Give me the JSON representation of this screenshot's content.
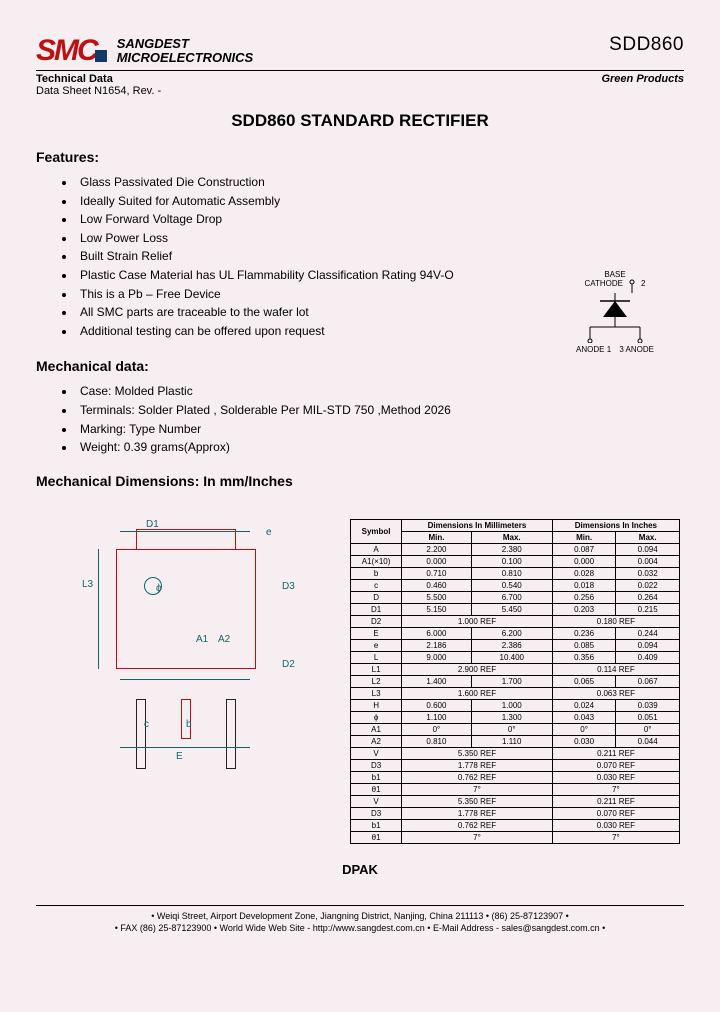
{
  "header": {
    "brand_line1": "SANGDEST",
    "brand_line2": "MICROELECTRONICS",
    "part_number": "SDD860",
    "tech_data": "Technical Data",
    "green": "Green Products",
    "datasheet": "Data Sheet N1654, Rev. -"
  },
  "title": "SDD860 STANDARD RECTIFIER",
  "features_heading": "Features:",
  "features": {
    "0": "Glass Passivated Die Construction",
    "1": "Ideally Suited for Automatic Assembly",
    "2": "Low Forward Voltage Drop",
    "3": "Low Power Loss",
    "4": "Built Strain Relief",
    "5": "Plastic Case Material has UL Flammability Classification Rating 94V-O",
    "6": "This is a Pb – Free Device",
    "7": "All SMC parts are traceable to the wafer lot",
    "8": "Additional testing can be offered upon request"
  },
  "symbol": {
    "base": "BASE",
    "cathode": "CATHODE",
    "pin2": "2",
    "anode1": "ANODE",
    "pin1": "1",
    "anode2": "ANODE",
    "pin3": "3"
  },
  "mech_heading": "Mechanical data:",
  "mech": {
    "0": "Case: Molded Plastic",
    "1": "Terminals: Solder Plated , Solderable Per MIL-STD 750 ,Method 2026",
    "2": "Marking: Type Number",
    "3": "Weight: 0.39 grams(Approx)"
  },
  "mechdim_heading": "Mechanical Dimensions: In mm/Inches",
  "drawing": {
    "D1": "D1",
    "e": "e",
    "D3": "D3",
    "A1": "A1",
    "A2": "A2",
    "D2": "D2",
    "c": "c",
    "b": "b",
    "E": "E",
    "L3": "L3",
    "phi": "ϕ"
  },
  "table": {
    "head": {
      "sym": "Symbol",
      "mm": "Dimensions In Millimeters",
      "in": "Dimensions In Inches",
      "min": "Min.",
      "max": "Max."
    },
    "rows": {
      "0": {
        "s": "A",
        "a": "2.200",
        "b": "2.380",
        "c": "0.087",
        "d": "0.094"
      },
      "1": {
        "s": "A1(×10)",
        "a": "0.000",
        "b": "0.100",
        "c": "0.000",
        "d": "0.004"
      },
      "2": {
        "s": "b",
        "a": "0.710",
        "b": "0.810",
        "c": "0.028",
        "d": "0.032"
      },
      "3": {
        "s": "c",
        "a": "0.460",
        "b": "0.540",
        "c": "0.018",
        "d": "0.022"
      },
      "4": {
        "s": "D",
        "a": "5.500",
        "b": "6.700",
        "c": "0.256",
        "d": "0.264"
      },
      "5": {
        "s": "D1",
        "a": "5.150",
        "b": "5.450",
        "c": "0.203",
        "d": "0.215"
      },
      "6": {
        "s": "D2",
        "a": "",
        "b": "1.000 REF",
        "c": "",
        "d": "0.180 REF",
        "ref": true
      },
      "7": {
        "s": "E",
        "a": "6.000",
        "b": "6.200",
        "c": "0.236",
        "d": "0.244"
      },
      "8": {
        "s": "e",
        "a": "2.186",
        "b": "2.386",
        "c": "0.085",
        "d": "0.094"
      },
      "9": {
        "s": "L",
        "a": "9.000",
        "b": "10.400",
        "c": "0.356",
        "d": "0.409"
      },
      "10": {
        "s": "L1",
        "a": "",
        "b": "2.900 REF",
        "c": "",
        "d": "0.114 REF",
        "ref": true
      },
      "11": {
        "s": "L2",
        "a": "1.400",
        "b": "1.700",
        "c": "0.065",
        "d": "0.067"
      },
      "12": {
        "s": "L3",
        "a": "",
        "b": "1.600 REF",
        "c": "",
        "d": "0.063 REF",
        "ref": true
      },
      "13": {
        "s": "H",
        "a": "0.600",
        "b": "1.000",
        "c": "0.024",
        "d": "0.039"
      },
      "14": {
        "s": "ϕ",
        "a": "1.100",
        "b": "1.300",
        "c": "0.043",
        "d": "0.051"
      },
      "15": {
        "s": "A1",
        "a": "0°",
        "b": "0°",
        "c": "0°",
        "d": "0°"
      },
      "16": {
        "s": "A2",
        "a": "0.810",
        "b": "1.110",
        "c": "0.030",
        "d": "0.044"
      },
      "17": {
        "s": "V",
        "a": "",
        "b": "5.350 REF",
        "c": "",
        "d": "0.211 REF",
        "ref": true
      },
      "18": {
        "s": "D3",
        "a": "",
        "b": "1.778 REF",
        "c": "",
        "d": "0.070 REF",
        "ref": true
      },
      "19": {
        "s": "b1",
        "a": "",
        "b": "0.762 REF",
        "c": "",
        "d": "0.030 REF",
        "ref": true
      },
      "20": {
        "s": "θ1",
        "a": "",
        "b": "7°",
        "c": "",
        "d": "7°",
        "ref": true
      },
      "21": {
        "s": "V",
        "a": "",
        "b": "5.350 REF",
        "c": "",
        "d": "0.211 REF",
        "ref": true
      },
      "22": {
        "s": "D3",
        "a": "",
        "b": "1.778 REF",
        "c": "",
        "d": "0.070 REF",
        "ref": true
      },
      "23": {
        "s": "b1",
        "a": "",
        "b": "0.762 REF",
        "c": "",
        "d": "0.030 REF",
        "ref": true
      },
      "24": {
        "s": "θ1",
        "a": "",
        "b": "7°",
        "c": "",
        "d": "7°",
        "ref": true
      }
    }
  },
  "package": "DPAK",
  "footer": {
    "line1": "• Weiqi Street, Airport Development Zone, Jiangning District, Nanjing, China 211113  • (86) 25-87123907 •",
    "line2": "• FAX (86) 25-87123900 • World Wide Web Site - http://www.sangdest.com.cn • E-Mail Address - sales@sangdest.com.cn •"
  }
}
